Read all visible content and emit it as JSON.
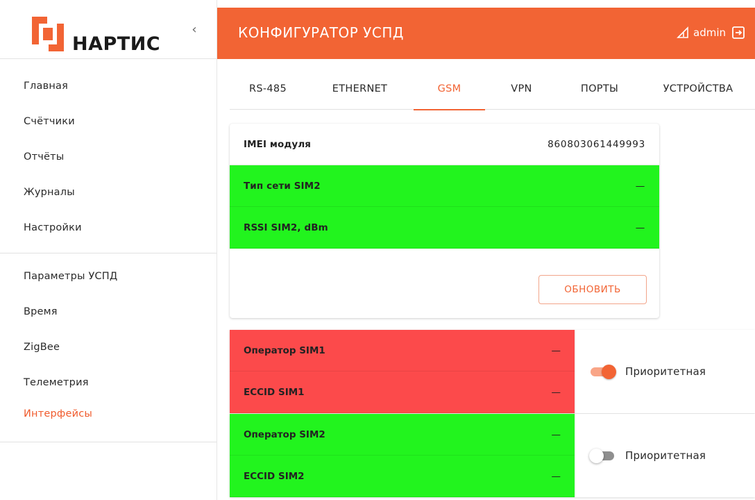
{
  "brand": {
    "name": "НАРТИС",
    "accent_color": "#f26434"
  },
  "sidebar": {
    "collapse_icon": "chevron-left-icon",
    "group1": [
      {
        "label": "Главная"
      },
      {
        "label": "Счётчики"
      },
      {
        "label": "Отчёты"
      },
      {
        "label": "Журналы"
      },
      {
        "label": "Настройки"
      }
    ],
    "group2": [
      {
        "label": "Параметры УСПД"
      },
      {
        "label": "Время"
      },
      {
        "label": "ZigBee"
      },
      {
        "label": "Телеметрия"
      },
      {
        "label": "Интерфейсы",
        "active": true
      }
    ]
  },
  "header": {
    "title": "КОНФИГУРАТОР УСПД",
    "user": "admin",
    "user_icon": "signal-edit-icon",
    "logout_icon": "logout-icon"
  },
  "tabs": [
    {
      "label": "RS-485"
    },
    {
      "label": "ETHERNET"
    },
    {
      "label": "GSM",
      "active": true
    },
    {
      "label": "VPN"
    },
    {
      "label": "ПОРТЫ"
    },
    {
      "label": "УСТРОЙСТВА"
    }
  ],
  "gsm_card": {
    "rows": [
      {
        "label": "IMEI модуля",
        "value": "860803061449993",
        "status": "none"
      },
      {
        "label": "Тип сети SIM2",
        "value": "—",
        "status": "green"
      },
      {
        "label": "RSSI SIM2, dBm",
        "value": "—",
        "status": "green"
      }
    ],
    "refresh_label": "ОБНОВИТЬ"
  },
  "sims": [
    {
      "status_color": "#fc4a4b",
      "rows": [
        {
          "label": "Оператор SIM1",
          "value": "—"
        },
        {
          "label": "ECCID SIM1",
          "value": "—"
        }
      ],
      "priority_label": "Приоритетная",
      "priority_on": true
    },
    {
      "status_color": "#22f41e",
      "rows": [
        {
          "label": "Оператор SIM2",
          "value": "—"
        },
        {
          "label": "ECCID SIM2",
          "value": "—"
        }
      ],
      "priority_label": "Приоритетная",
      "priority_on": false
    }
  ]
}
